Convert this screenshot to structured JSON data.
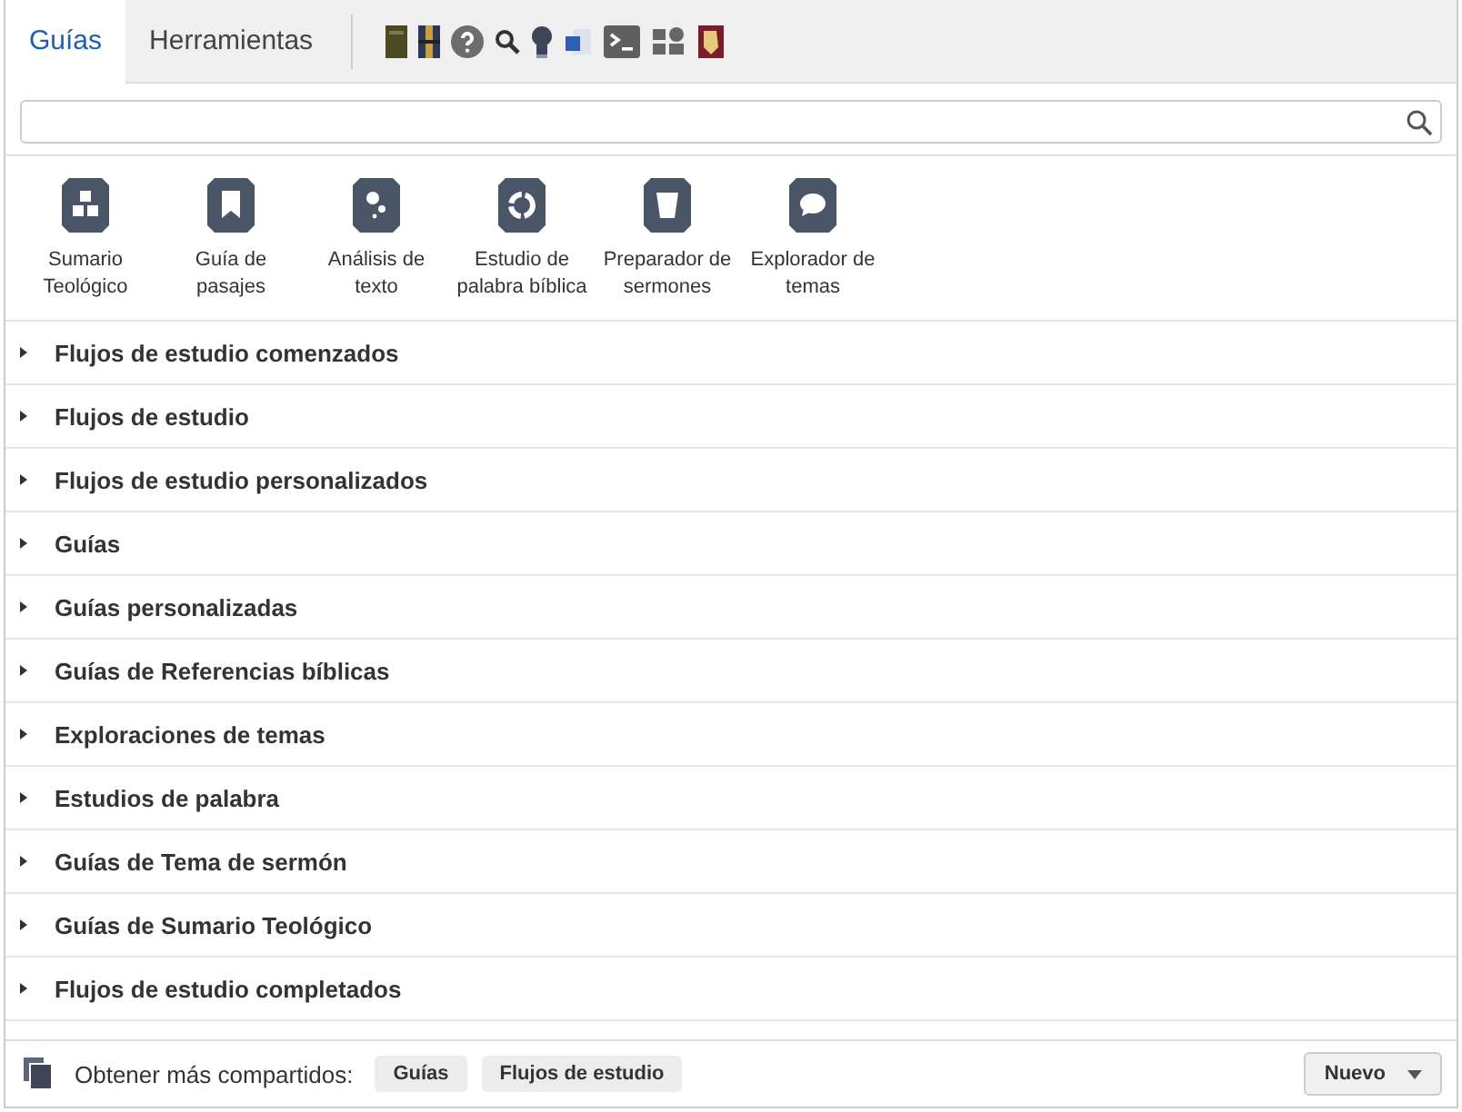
{
  "tabs": [
    {
      "label": "Guías",
      "selected": true
    },
    {
      "label": "Herramientas",
      "selected": false
    }
  ],
  "guides": [
    {
      "label": "Sumario Teológico"
    },
    {
      "label": "Guía de pasajes"
    },
    {
      "label": "Análisis de texto"
    },
    {
      "label": "Estudio de palabra bíblica"
    },
    {
      "label": "Preparador de sermones"
    },
    {
      "label": "Explorador de temas"
    }
  ],
  "sections": [
    {
      "label": "Flujos de estudio comenzados",
      "expanded": false
    },
    {
      "label": "Flujos de estudio",
      "expanded": false
    },
    {
      "label": "Flujos de estudio personalizados",
      "expanded": false
    },
    {
      "label": "Guías",
      "expanded": false
    },
    {
      "label": "Guías personalizadas",
      "expanded": false
    },
    {
      "label": "Guías de Referencias bíblicas",
      "expanded": false
    },
    {
      "label": "Exploraciones de temas",
      "expanded": false
    },
    {
      "label": "Estudios de palabra",
      "expanded": false
    },
    {
      "label": "Guías de Tema de sermón",
      "expanded": false
    },
    {
      "label": "Guías de Sumario Teológico",
      "expanded": false
    },
    {
      "label": "Flujos de estudio completados",
      "expanded": false
    }
  ],
  "footer": {
    "label": "Obtener más compartidos:",
    "buttons": [
      "Guías",
      "Flujos de estudio"
    ],
    "menu_button": "Nuevo"
  }
}
